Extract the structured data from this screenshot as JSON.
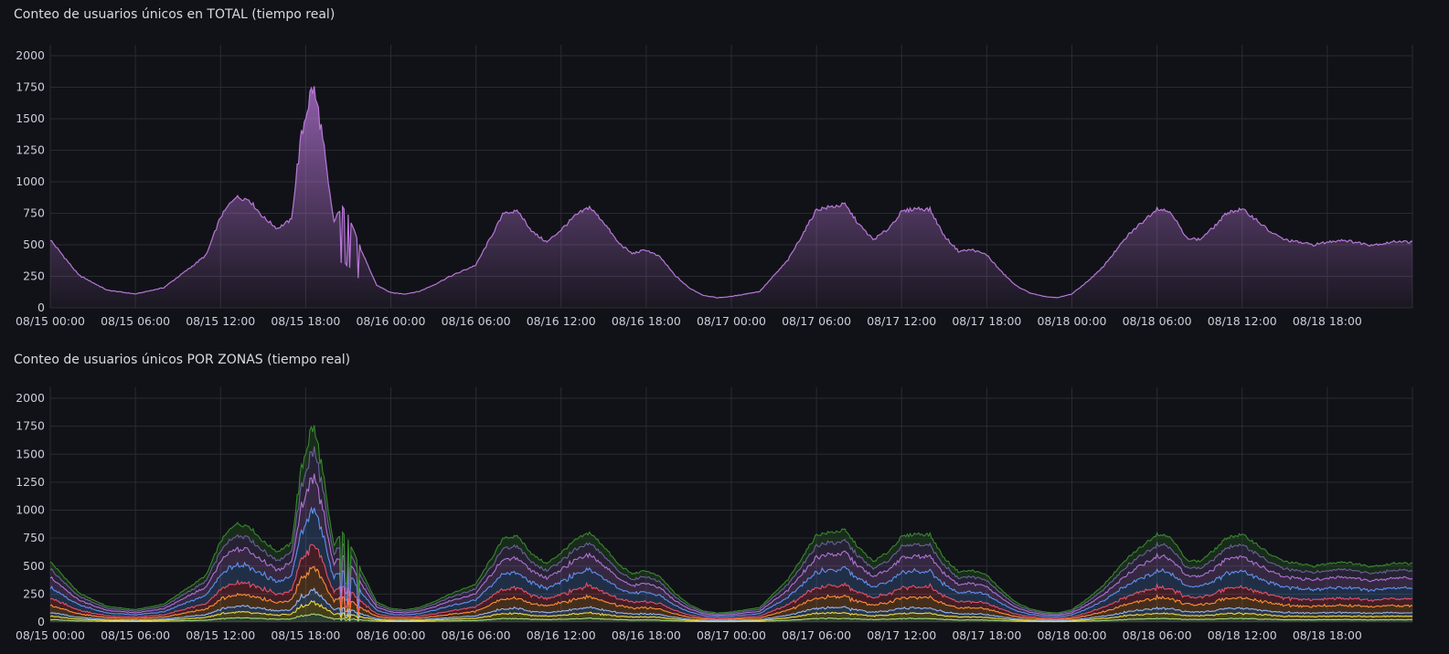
{
  "chart_data": [
    {
      "type": "area",
      "title": "Conteo de usuarios únicos en TOTAL (tiempo real)",
      "yticks": [
        "0",
        "250",
        "500",
        "750",
        "1000",
        "1250",
        "1500",
        "1750",
        "2000"
      ],
      "ylim": [
        0,
        2000
      ],
      "xticks": [
        "08/15 00:00",
        "08/15 06:00",
        "08/15 12:00",
        "08/15 18:00",
        "08/16 00:00",
        "08/16 06:00",
        "08/16 12:00",
        "08/16 18:00",
        "08/17 00:00",
        "08/17 06:00",
        "08/17 12:00",
        "08/17 18:00",
        "08/18 00:00",
        "08/18 06:00",
        "08/18 12:00",
        "08/18 18:00"
      ],
      "xlim_hours": [
        0,
        96
      ],
      "grid": true,
      "color": "#b877d9",
      "series": [
        {
          "x_hours": [
            0,
            2,
            4,
            6,
            8,
            10,
            11,
            12,
            13,
            14,
            15,
            16,
            17,
            17.5,
            18,
            18.5,
            19,
            19.5,
            20,
            20.5,
            21,
            22,
            23,
            24,
            25,
            26,
            27,
            28,
            30,
            32,
            33,
            34,
            35,
            36,
            37,
            38,
            39,
            40,
            41,
            42,
            43,
            44,
            45,
            46,
            47,
            48,
            50,
            52,
            54,
            56,
            57,
            58,
            59,
            60,
            61,
            62,
            63,
            64,
            65,
            66,
            67,
            68,
            69,
            70,
            71,
            72,
            73,
            74,
            76,
            78,
            79,
            80,
            81,
            82,
            83,
            84,
            85,
            86,
            87,
            88,
            89,
            90,
            91,
            92,
            93,
            94,
            95,
            96
          ],
          "values": [
            540,
            260,
            140,
            110,
            160,
            330,
            420,
            720,
            880,
            860,
            720,
            630,
            700,
            1200,
            1550,
            1750,
            1500,
            1050,
            680,
            800,
            750,
            430,
            180,
            120,
            110,
            130,
            180,
            240,
            340,
            760,
            760,
            600,
            520,
            620,
            730,
            800,
            680,
            520,
            430,
            460,
            400,
            260,
            160,
            100,
            80,
            90,
            130,
            380,
            780,
            820,
            660,
            540,
            620,
            760,
            790,
            780,
            570,
            450,
            460,
            420,
            290,
            180,
            120,
            90,
            80,
            110,
            200,
            300,
            580,
            790,
            760,
            560,
            540,
            640,
            760,
            780,
            700,
            600,
            540,
            520,
            500,
            520,
            540,
            520,
            500,
            510,
            530,
            520
          ]
        }
      ]
    },
    {
      "type": "area",
      "stacked": true,
      "title": "Conteo de usuarios únicos POR ZONAS (tiempo real)",
      "yticks": [
        "0",
        "250",
        "500",
        "750",
        "1000",
        "1250",
        "1500",
        "1750",
        "2000"
      ],
      "ylim": [
        0,
        2000
      ],
      "xticks": [
        "08/15 00:00",
        "08/15 06:00",
        "08/15 12:00",
        "08/15 18:00",
        "08/16 00:00",
        "08/16 06:00",
        "08/16 12:00",
        "08/16 18:00",
        "08/17 00:00",
        "08/17 06:00",
        "08/17 12:00",
        "08/17 18:00",
        "08/18 00:00",
        "08/18 06:00",
        "08/18 12:00",
        "08/18 18:00"
      ],
      "xlim_hours": [
        0,
        96
      ],
      "grid": true,
      "layer_fractions": [
        0.04,
        0.06,
        0.06,
        0.12,
        0.12,
        0.18,
        0.17,
        0.13,
        0.12
      ],
      "layer_colors": [
        "#96d98d",
        "#fade2a",
        "#8ab8ff",
        "#ff9830",
        "#f2495c",
        "#5794f2",
        "#b877d9",
        "#705da0",
        "#37872d"
      ]
    }
  ]
}
